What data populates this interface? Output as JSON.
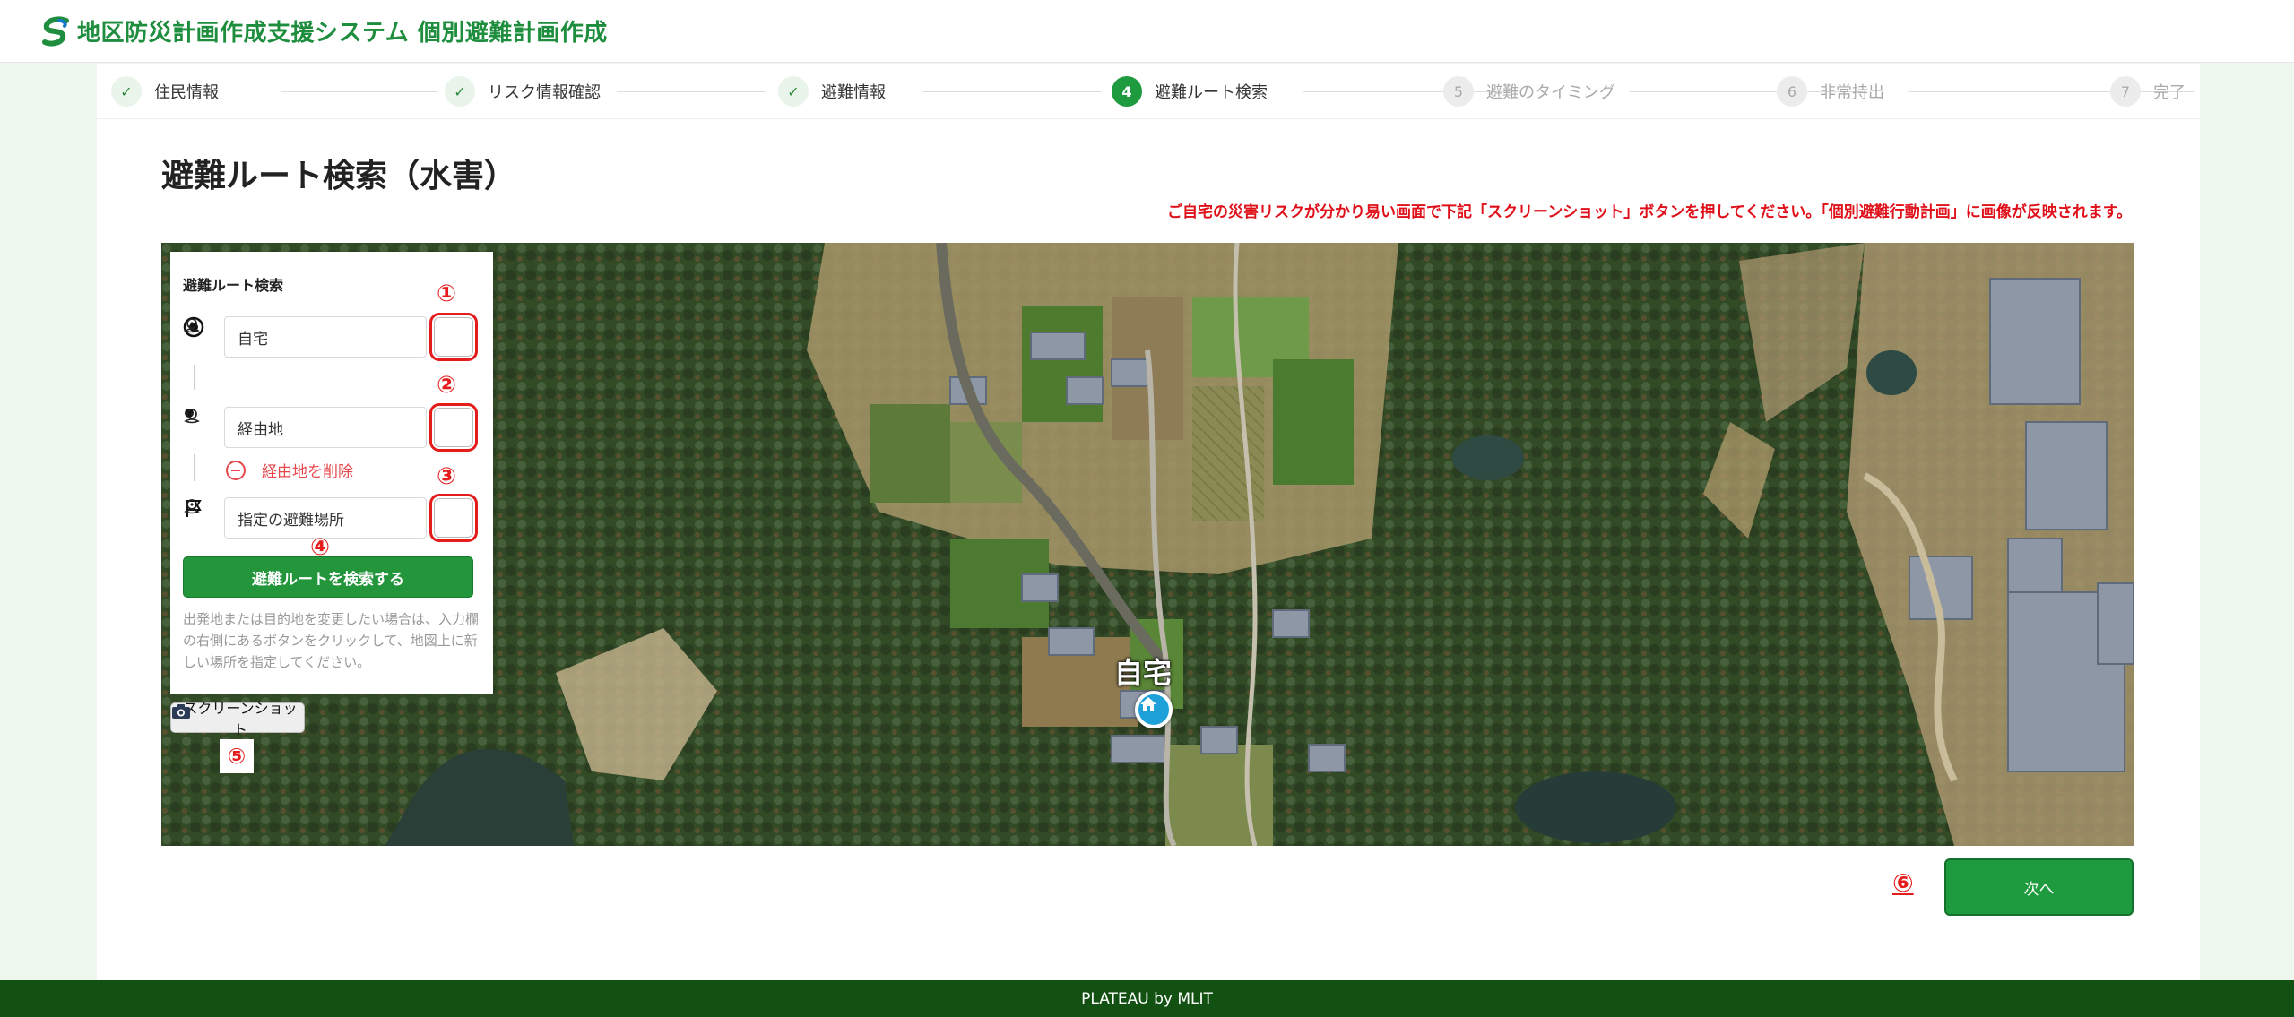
{
  "header": {
    "app_title": "地区防災計画作成支援システム 個別避難計画作成"
  },
  "steps": [
    {
      "number": "1",
      "label": "住民情報",
      "state": "done"
    },
    {
      "number": "2",
      "label": "リスク情報確認",
      "state": "done"
    },
    {
      "number": "3",
      "label": "避難情報",
      "state": "done"
    },
    {
      "number": "4",
      "label": "避難ルート検索",
      "state": "active"
    },
    {
      "number": "5",
      "label": "避難のタイミング",
      "state": "todo"
    },
    {
      "number": "6",
      "label": "非常持出",
      "state": "todo"
    },
    {
      "number": "7",
      "label": "完了",
      "state": "todo"
    }
  ],
  "page": {
    "title": "避難ルート検索（水害）",
    "notice": "ご自宅の災害リスクが分かり易い画面で下記「スクリーンショット」ボタンを押してください。「個別避難行動計画」に画像が反映されます。"
  },
  "route_panel": {
    "title": "避難ルート検索",
    "origin_value": "自宅",
    "waypoint_value": "経由地",
    "remove_waypoint": "経由地を削除",
    "destination_value": "指定の避難場所",
    "search_button": "避難ルートを検索する",
    "help_text": "出発地または目的地を変更したい場合は、入力欄の右側にあるボタンをクリックして、地図上に新しい場所を指定してください。"
  },
  "markers": {
    "m1": "①",
    "m2": "②",
    "m3": "③",
    "m4": "④",
    "m5": "⑤",
    "m6": "⑥"
  },
  "map": {
    "home_label": "自宅"
  },
  "screenshot_button": "スクリーンショット",
  "next_button": "次へ",
  "footer": "PLATEAU by MLIT",
  "colors": {
    "brand_green": "#1f9b3f",
    "footer_green": "#135112",
    "annotation_red": "#e41c1c"
  }
}
